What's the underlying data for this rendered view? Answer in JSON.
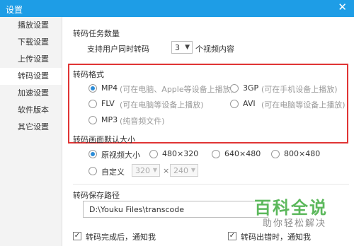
{
  "window": {
    "title": "设置",
    "close": "✕"
  },
  "sidebar": {
    "items": [
      {
        "label": "播放设置"
      },
      {
        "label": "下载设置"
      },
      {
        "label": "上传设置"
      },
      {
        "label": "转码设置",
        "active": true
      },
      {
        "label": "加速设置"
      },
      {
        "label": "软件版本"
      },
      {
        "label": "其它设置"
      }
    ]
  },
  "task_count": {
    "heading": "转码任务数量",
    "prefix": "支持用户同时转码",
    "value": "3",
    "suffix": "个视频内容"
  },
  "format": {
    "heading": "转码格式",
    "options": [
      {
        "name": "MP4",
        "hint": "(可在电脑、Apple等设备上播放)",
        "selected": true
      },
      {
        "name": "3GP",
        "hint": "(可在手机设备上播放)",
        "selected": false
      },
      {
        "name": "FLV",
        "hint": "(可在电脑等设备上播放)",
        "selected": false
      },
      {
        "name": "AVI",
        "hint": "(可在电脑等设备上播放)",
        "selected": false
      },
      {
        "name": "MP3",
        "hint": "(纯音频文件)",
        "selected": false
      }
    ]
  },
  "resolution": {
    "heading": "转码画面默认大小",
    "options": [
      {
        "label": "原视频大小",
        "selected": true
      },
      {
        "label": "480×320",
        "selected": false
      },
      {
        "label": "640×480",
        "selected": false
      },
      {
        "label": "800×480",
        "selected": false
      }
    ],
    "custom_label": "自定义",
    "custom_width": "320",
    "custom_times": "×",
    "custom_height": "240"
  },
  "save_path": {
    "heading": "转码保存路径",
    "value": "D:\\Youku Files\\transcode"
  },
  "notify": {
    "done_label": "转码完成后，通知我",
    "done_checked": true,
    "error_label": "转码出错时，通知我",
    "error_checked": true,
    "check_mark": "✓"
  },
  "watermark": {
    "title": "百科全说",
    "subtitle": "助你轻松解决"
  }
}
